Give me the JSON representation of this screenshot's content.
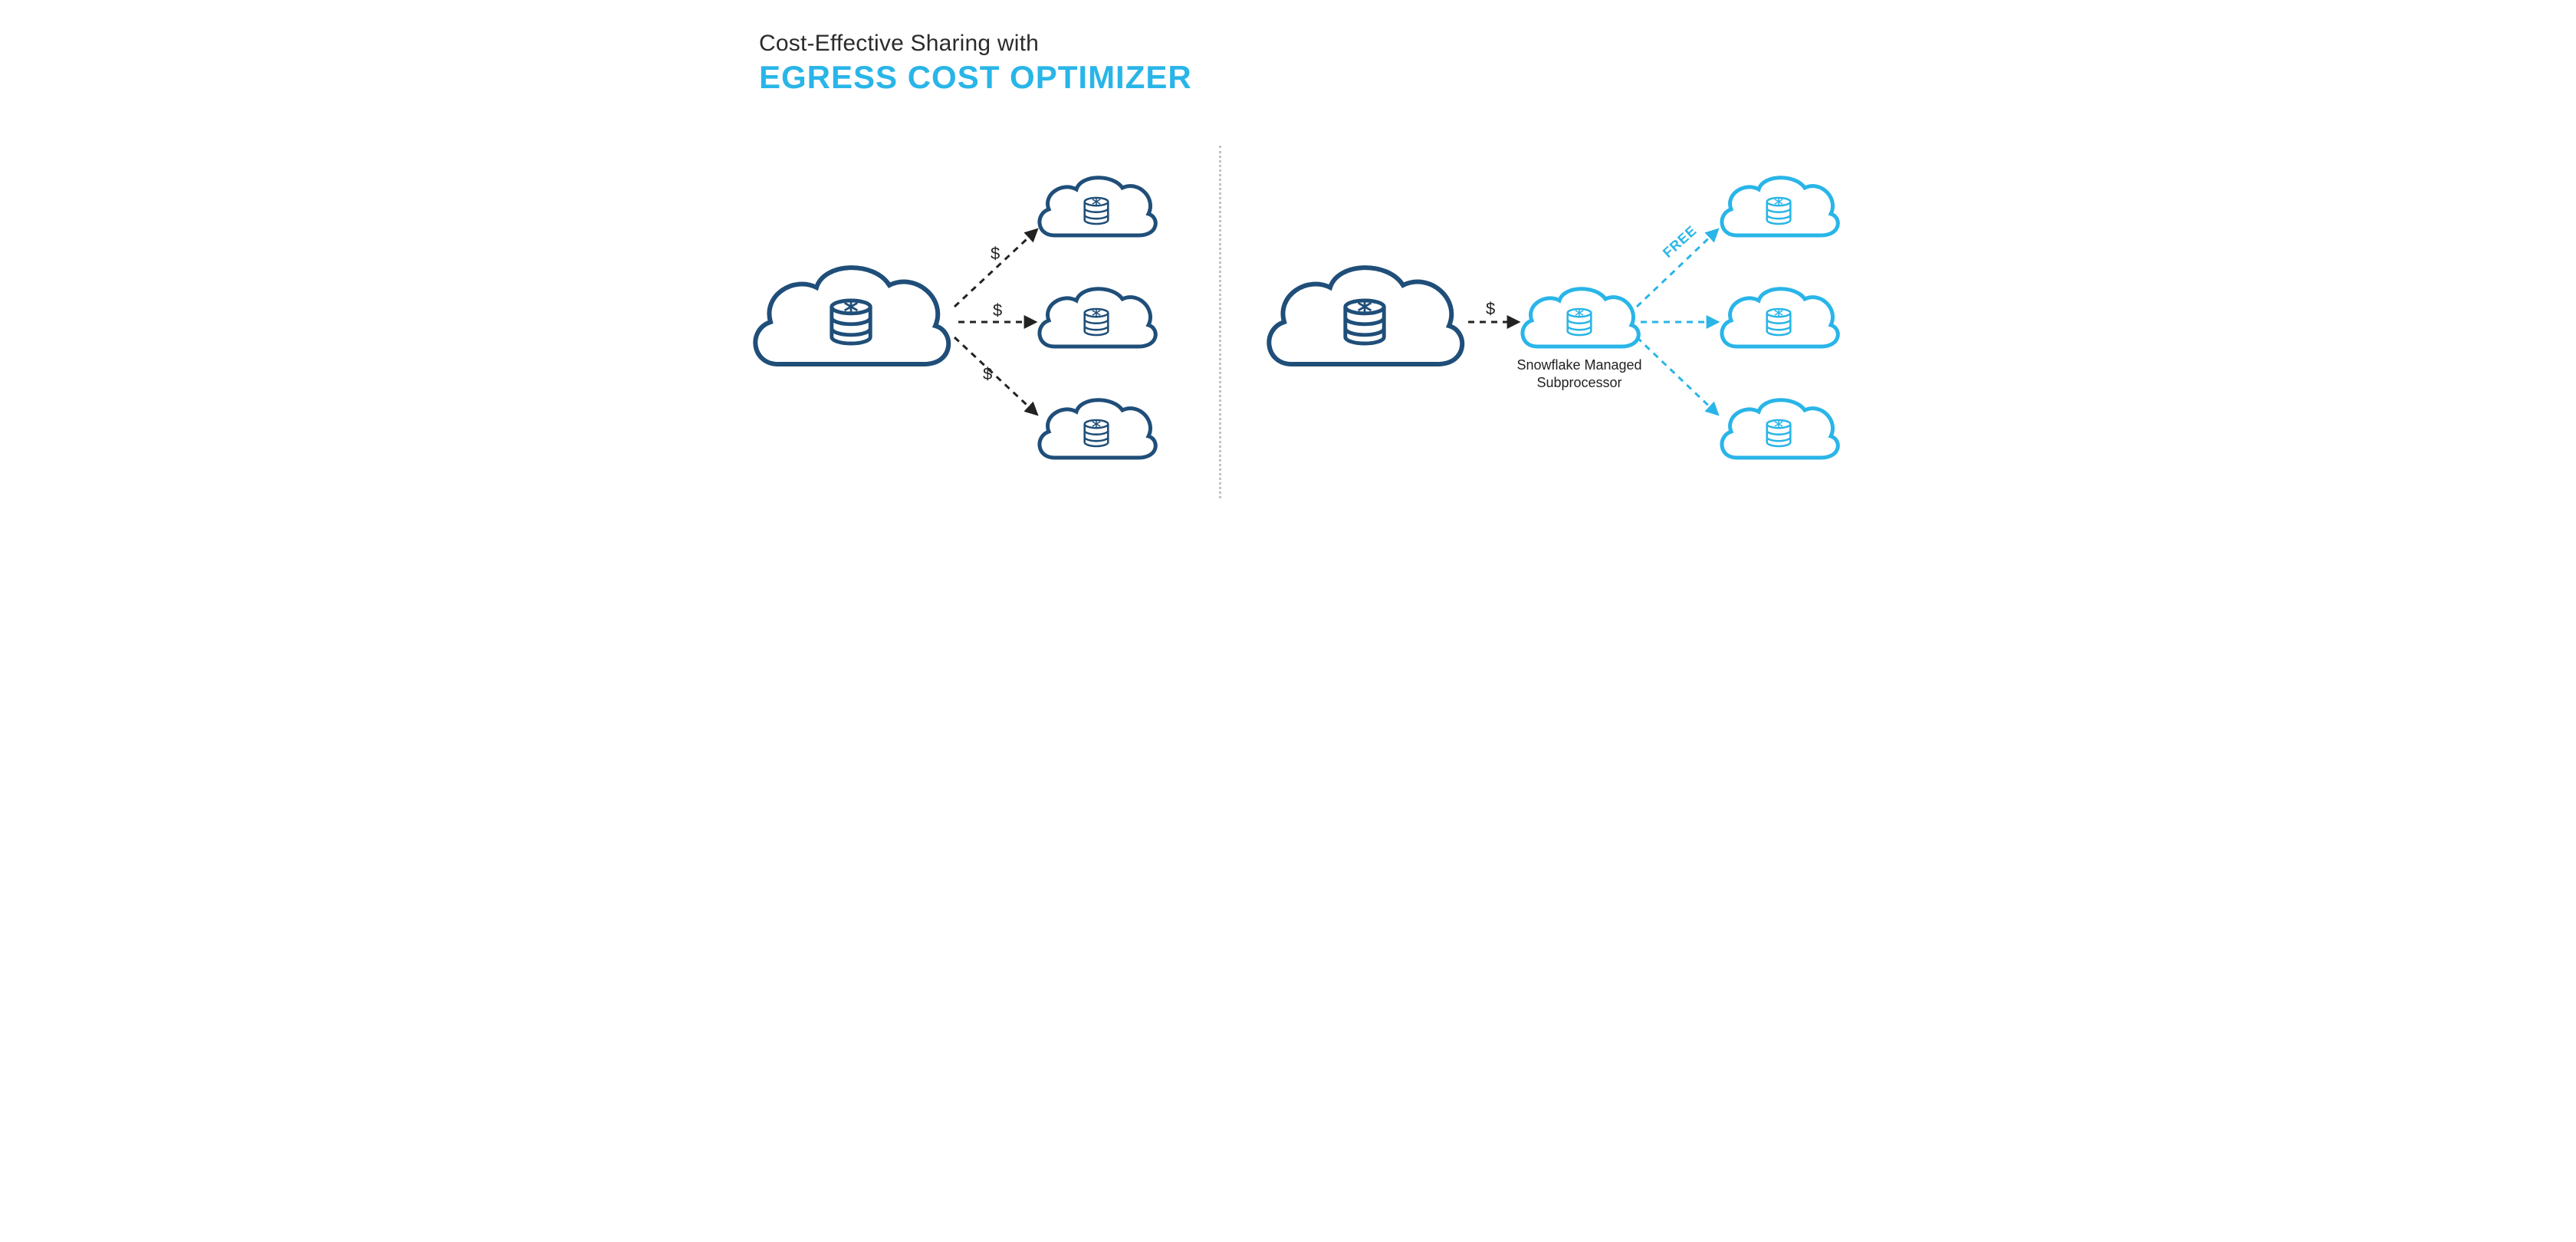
{
  "title": {
    "line1": "Cost-Effective Sharing with",
    "line2": "EGRESS COST OPTIMIZER"
  },
  "left": {
    "cost1": "$",
    "cost2": "$",
    "cost3": "$"
  },
  "right": {
    "cost": "$",
    "free": "FREE",
    "subprocessor_line1": "Snowflake Managed",
    "subprocessor_line2": "Subprocessor"
  },
  "colors": {
    "dark": "#1f4e79",
    "light": "#29b5e8",
    "arrow_dark": "#222222"
  }
}
